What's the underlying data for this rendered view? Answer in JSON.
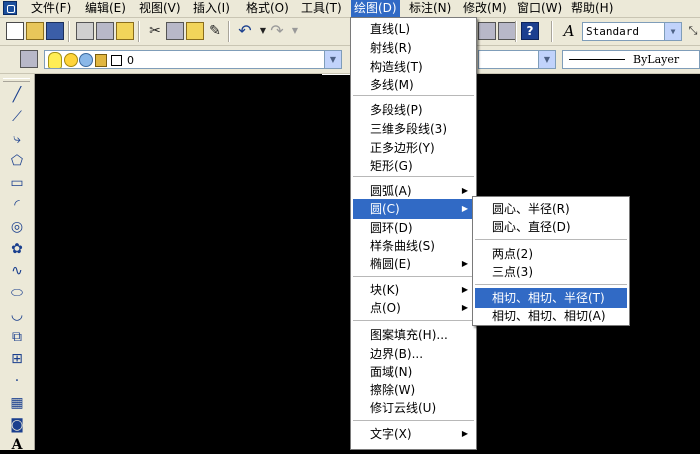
{
  "menubar": {
    "items": [
      {
        "label": "文件(F)"
      },
      {
        "label": "编辑(E)"
      },
      {
        "label": "视图(V)"
      },
      {
        "label": "插入(I)"
      },
      {
        "label": "格式(O)"
      },
      {
        "label": "工具(T)"
      },
      {
        "label": "绘图(D)"
      },
      {
        "label": "标注(N)"
      },
      {
        "label": "修改(M)"
      },
      {
        "label": "窗口(W)"
      },
      {
        "label": "帮助(H)"
      }
    ],
    "active_index": 6
  },
  "toolbar": {
    "text_style": "Standard",
    "layer_name": "0",
    "linetype": "ByLayer"
  },
  "draw_menu": {
    "items": [
      {
        "label": "直线(L)"
      },
      {
        "label": "射线(R)"
      },
      {
        "label": "构造线(T)"
      },
      {
        "label": "多线(M)"
      },
      {
        "label": "多段线(P)"
      },
      {
        "label": "三维多段线(3)"
      },
      {
        "label": "正多边形(Y)"
      },
      {
        "label": "矩形(G)"
      },
      {
        "label": "圆弧(A)"
      },
      {
        "label": "圆(C)"
      },
      {
        "label": "圆环(D)"
      },
      {
        "label": "样条曲线(S)"
      },
      {
        "label": "椭圆(E)"
      },
      {
        "label": "块(K)"
      },
      {
        "label": "点(O)"
      },
      {
        "label": "图案填充(H)..."
      },
      {
        "label": "边界(B)..."
      },
      {
        "label": "面域(N)"
      },
      {
        "label": "擦除(W)"
      },
      {
        "label": "修订云线(U)"
      },
      {
        "label": "文字(X)"
      }
    ]
  },
  "circle_submenu": {
    "items": [
      {
        "label": "圆心、半径(R)"
      },
      {
        "label": "圆心、直径(D)"
      },
      {
        "label": "两点(2)"
      },
      {
        "label": "三点(3)"
      },
      {
        "label": "相切、相切、半径(T)"
      },
      {
        "label": "相切、相切、相切(A)"
      }
    ]
  },
  "colors": {
    "highlight": "#316ac5",
    "chrome": "#ece9d8",
    "canvas": "#000000"
  }
}
